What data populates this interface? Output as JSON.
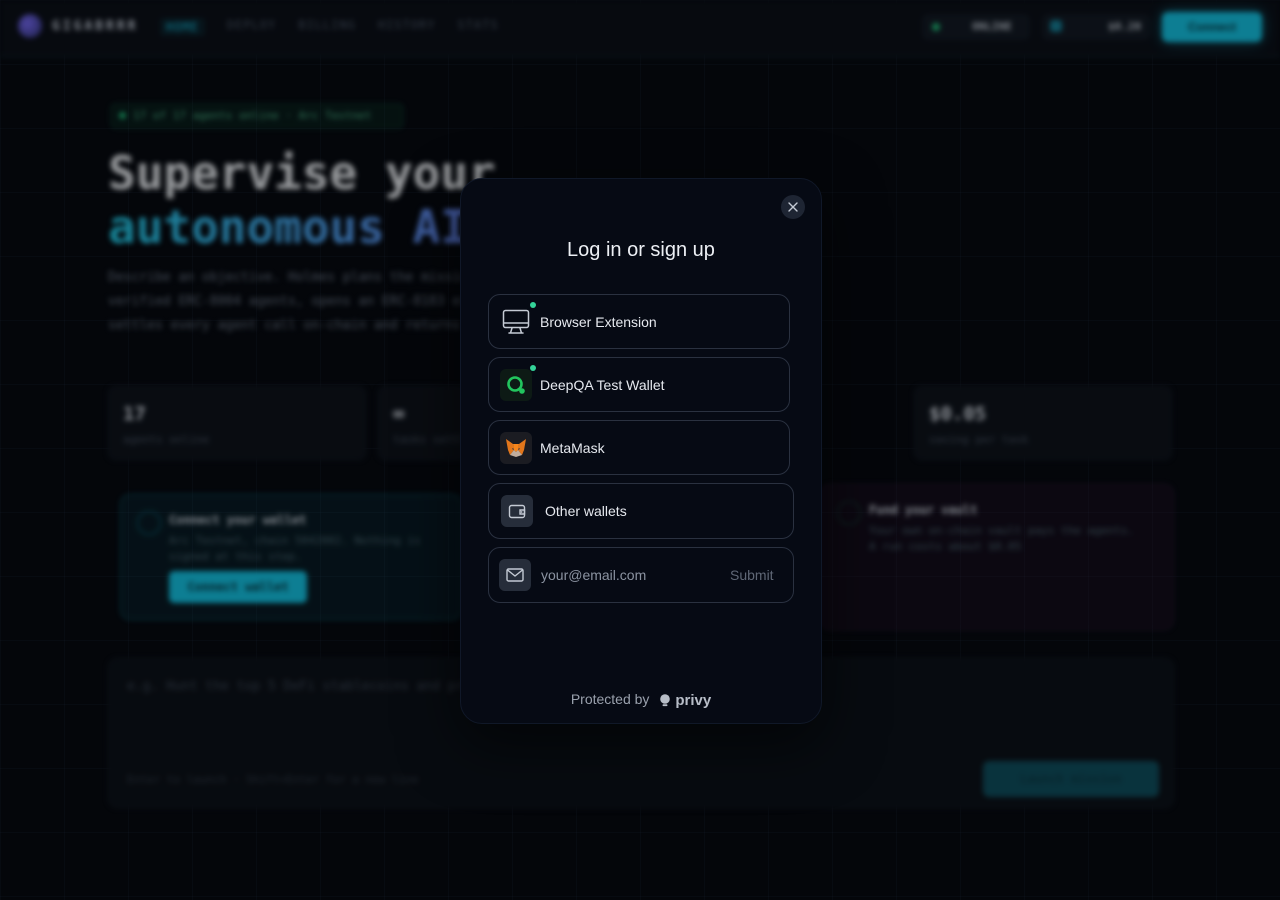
{
  "app": {
    "brand": "GIGABRRR",
    "nav": [
      "HOME",
      "DEPLOY",
      "BILLING",
      "HISTORY",
      "STATS"
    ],
    "network_status": "ONLINE",
    "balance": "$0.20",
    "connect_label": "Connect"
  },
  "hero": {
    "badge": "17 of 17 agents online · Arc Testnet",
    "line1": "Supervise your",
    "line2": "autonomous AI",
    "description": "Describe an objective. Holmes plans the mission, hires verified ERC-8004 agents, opens an ERC-8183 escrow vault, settles every agent call on-chain and returns the report."
  },
  "stats": [
    {
      "value": "17",
      "label": "agents online"
    },
    {
      "value": "∞",
      "label": "tasks settled"
    },
    {
      "value": "$0.05",
      "label": "saving per task"
    }
  ],
  "steps": {
    "connect": {
      "title": "Connect your wallet",
      "description": "Arc Testnet, chain 5042002. Nothing is signed at this step.",
      "button": "Connect wallet"
    },
    "fund": {
      "title": "Fund your vault",
      "description": "Your own on-chain vault pays the agents. A run costs about $0.05"
    }
  },
  "prompt": {
    "placeholder": "e.g. Hunt the top 5 DeFi stablecoins and produce a risk-adjusted report",
    "hint": "Enter to launch · Shift+Enter for a new line",
    "launch": "Launch mission"
  },
  "modal": {
    "title": "Log in or sign up",
    "options": [
      {
        "label": "Browser Extension",
        "icon": "monitor-icon"
      },
      {
        "label": "DeepQA Test Wallet",
        "icon": "deepqa-logo-icon"
      },
      {
        "label": "MetaMask",
        "icon": "metamask-fox-icon"
      },
      {
        "label": "Other wallets",
        "icon": "wallet-icon"
      }
    ],
    "email": {
      "placeholder": "your@email.com",
      "value": "",
      "submit": "Submit"
    },
    "footer": {
      "protected_by": "Protected by",
      "provider": "privy"
    }
  },
  "colors": {
    "accent": "#14c8e8",
    "online": "#34d399",
    "modal_bg": "#060a14",
    "page_bg": "#05070c"
  }
}
